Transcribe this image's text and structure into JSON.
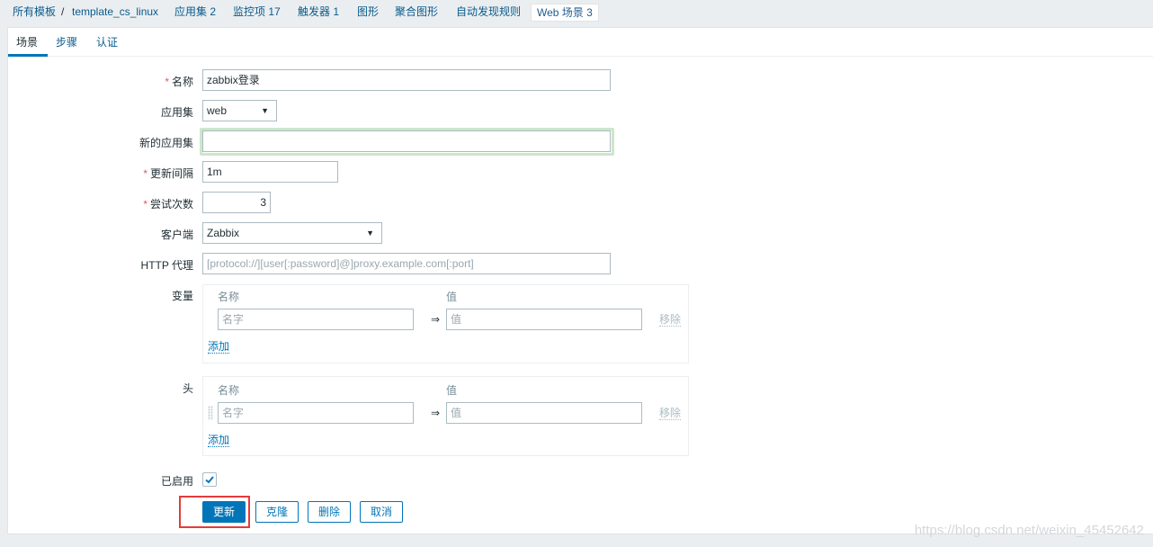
{
  "breadcrumb": {
    "all_templates": "所有模板",
    "separator": "/",
    "template": "template_cs_linux",
    "applications": "应用集 2",
    "items": "监控项 17",
    "triggers": "触发器 1",
    "graphs": "图形",
    "screens": "聚合图形",
    "discovery": "自动发现规则",
    "web_scenarios": "Web 场景 3"
  },
  "tabs": [
    {
      "label": "场景",
      "active": true
    },
    {
      "label": "步骤",
      "active": false
    },
    {
      "label": "认证",
      "active": false
    }
  ],
  "form": {
    "required_mark": "*",
    "name": {
      "label": "名称",
      "value": "zabbix登录"
    },
    "application": {
      "label": "应用集",
      "value": "web"
    },
    "new_application": {
      "label": "新的应用集",
      "value": ""
    },
    "update_interval": {
      "label": "更新间隔",
      "value": "1m"
    },
    "attempts": {
      "label": "尝试次数",
      "value": "3"
    },
    "agent": {
      "label": "客户端",
      "value": "Zabbix"
    },
    "http_proxy": {
      "label": "HTTP 代理",
      "placeholder": "[protocol://][user[:password]@]proxy.example.com[:port]"
    },
    "variables": {
      "label": "变量",
      "col_name": "名称",
      "col_value": "值",
      "name_placeholder": "名字",
      "value_placeholder": "值",
      "arrow": "⇒",
      "remove": "移除",
      "add": "添加"
    },
    "headers": {
      "label": "头",
      "col_name": "名称",
      "col_value": "值",
      "name_placeholder": "名字",
      "value_placeholder": "值",
      "arrow": "⇒",
      "remove": "移除",
      "add": "添加"
    },
    "enabled": {
      "label": "已启用",
      "checked": true
    }
  },
  "buttons": {
    "update": "更新",
    "clone": "克隆",
    "delete": "删除",
    "cancel": "取消"
  },
  "colors": {
    "accent": "#0275b8",
    "required": "#e45959",
    "highlight": "#e53b3b"
  },
  "watermark": "https://blog.csdn.net/weixin_45452642"
}
